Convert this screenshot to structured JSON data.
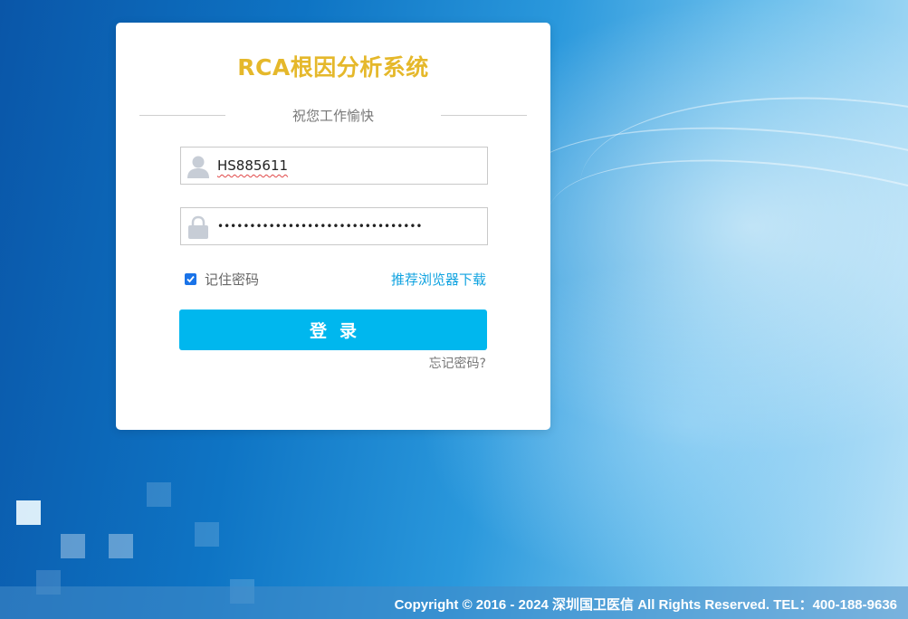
{
  "login": {
    "title": "RCA根因分析系统",
    "greeting": "祝您工作愉快",
    "username": {
      "value": "HS885611",
      "icon": "user-icon"
    },
    "password": {
      "masked_value": "••••••••••••••••••••••••••••••••",
      "icon": "lock-icon"
    },
    "remember_label": "记住密码",
    "remember_checked": true,
    "browser_link_label": "推荐浏览器下载",
    "submit_label": "登录",
    "forgot_label": "忘记密码?"
  },
  "footer": {
    "copyright": "Copyright © 2016 - 2024 深圳国卫医信 All Rights Reserved. TEL：400-188-9636"
  },
  "colors": {
    "title": "#e5b82b",
    "button": "#00b7ee",
    "link": "#10a3e0",
    "checkbox": "#1a73e8"
  }
}
